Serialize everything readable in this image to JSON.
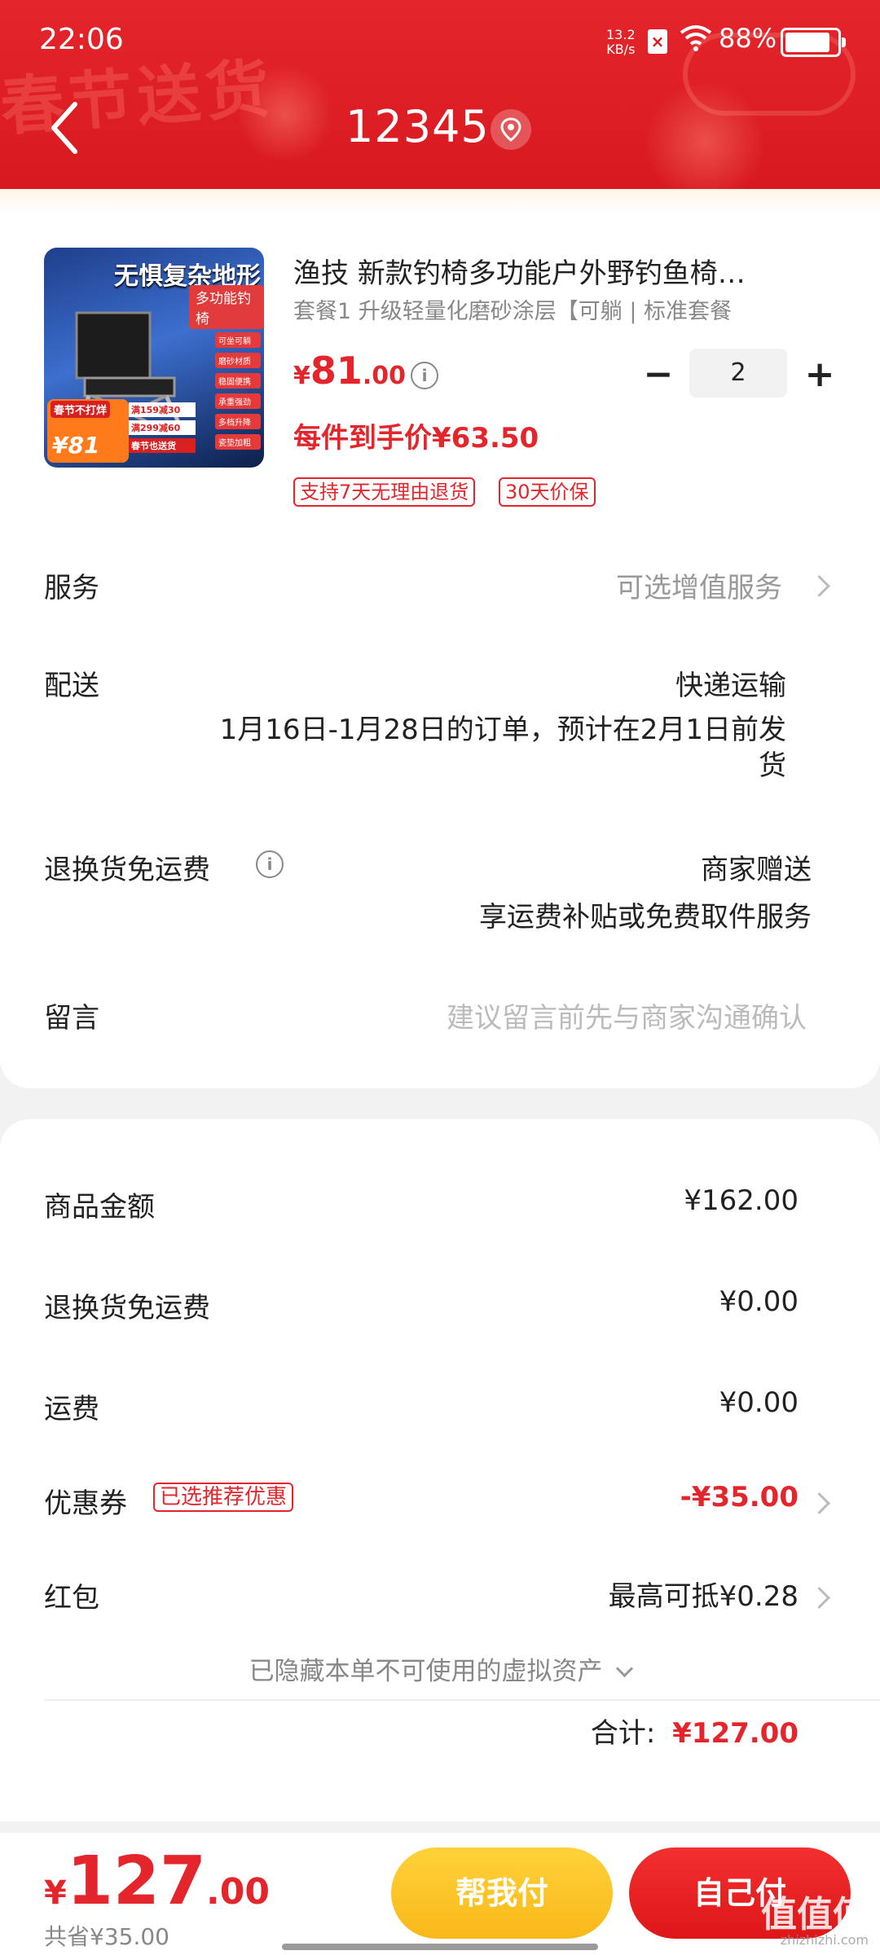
{
  "status_bar": {
    "time": "22:06",
    "net_speed_top": "13.2",
    "net_speed_bottom": "KB/s",
    "battery": "88%"
  },
  "header": {
    "banner_text": "春节送货",
    "title": "12345"
  },
  "product": {
    "title": "渔技 新款钓椅多功能户外野钓鱼椅…",
    "spec": "套餐1 升级轻量化磨砂涂层【可躺 | 标准套餐",
    "price_currency": "¥",
    "price_int": "81",
    "price_dec": ".00",
    "quantity": "2",
    "unit_price_text": "每件到手价¥63.50",
    "badges": [
      "支持7天无理由退货",
      "30天价保"
    ],
    "image_title": "无惧复杂地形",
    "image_subtitle": "多功能钓椅",
    "image_tags": [
      "可坐可躺",
      "磨砂材质",
      "稳固便携",
      "承重强劲",
      "多档升降",
      "瓷垫加粗"
    ],
    "image_promo_top": "春节不打烊",
    "image_promo_price": "¥81",
    "image_coupons": [
      "满159减30",
      "满299减60",
      "春节也送货"
    ]
  },
  "rows": {
    "service_label": "服务",
    "service_hint": "可选增值服务",
    "delivery_label": "配送",
    "delivery_method": "快递运输",
    "delivery_note_line1": "1月16日-1月28日的订单，预计在2月1日前发",
    "delivery_note_line2": "货",
    "return_label": "退换货免运费",
    "return_value": "商家赠送",
    "return_note": "享运费补贴或免费取件服务",
    "message_label": "留言",
    "message_placeholder": "建议留言前先与商家沟通确认"
  },
  "summary": {
    "goods_label": "商品金额",
    "goods_value": "¥162.00",
    "return_fee_label": "退换货免运费",
    "return_fee_value": "¥0.00",
    "shipping_label": "运费",
    "shipping_value": "¥0.00",
    "coupon_label": "优惠券",
    "coupon_badge": "已选推荐优惠",
    "coupon_value": "-¥35.00",
    "redpacket_label": "红包",
    "redpacket_value": "最高可抵¥0.28",
    "hidden_assets": "已隐藏本单不可使用的虚拟资产",
    "total_label": "合计:",
    "total_value": "¥127.00"
  },
  "bottom": {
    "currency": "¥",
    "total_int": "127",
    "total_dec": ".00",
    "saved": "共省¥35.00",
    "help_pay": "帮我付",
    "self_pay": "自己付",
    "watermark": "值值值",
    "watermark_sub": "zhizhizhi.com"
  },
  "colors": {
    "accent": "#e4262c",
    "help_button": "#f9b81a",
    "self_button": "#de1618"
  }
}
